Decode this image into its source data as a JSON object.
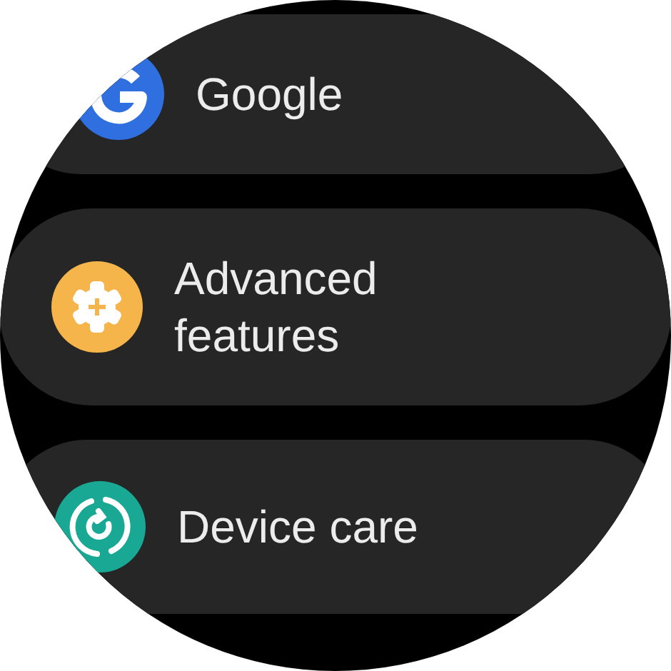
{
  "settings_list": [
    {
      "label": "Google"
    },
    {
      "label": "Advanced features"
    },
    {
      "label": "Device care"
    }
  ]
}
